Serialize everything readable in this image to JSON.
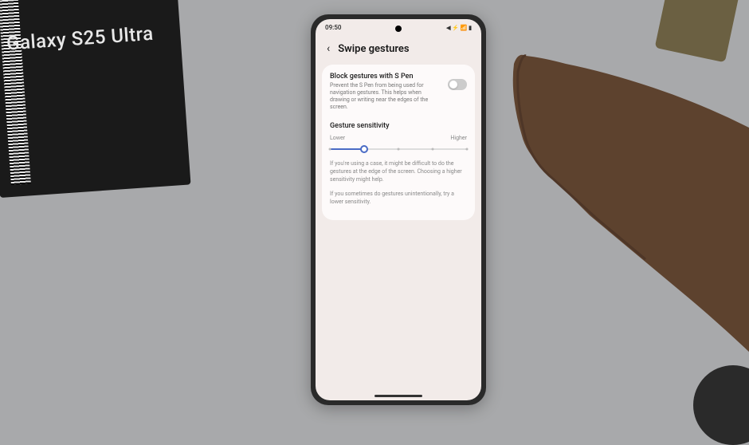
{
  "box": {
    "product_name": "Galaxy S25 Ultra"
  },
  "phone": {
    "status": {
      "time": "09:50",
      "icons": "◀ ⚡ 📶 ▮"
    },
    "header": {
      "title": "Swipe gestures"
    },
    "settings": {
      "block_spen": {
        "title": "Block gestures with S Pen",
        "desc": "Prevent the S Pen from being used for navigation gestures. This helps when drawing or writing near the edges of the screen."
      },
      "sensitivity": {
        "title": "Gesture sensitivity",
        "lower": "Lower",
        "higher": "Higher",
        "help1": "If you're using a case, it might be difficult to do the gestures at the edge of the screen. Choosing a higher sensitivity might help.",
        "help2": "If you sometimes do gestures unintentionally, try a lower sensitivity."
      }
    }
  }
}
